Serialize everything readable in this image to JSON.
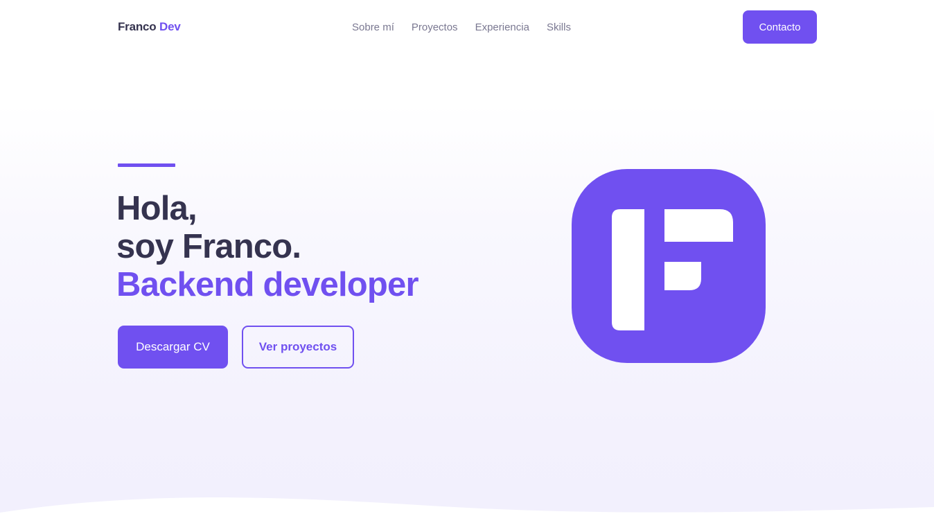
{
  "header": {
    "brand_first": "Franco",
    "brand_second": "Dev",
    "nav": [
      "Sobre mí",
      "Proyectos",
      "Experiencia",
      "Skills"
    ],
    "contact_label": "Contacto"
  },
  "hero": {
    "line1": "Hola,",
    "line2": "soy Franco.",
    "role": "Backend developer",
    "primary_button": "Descargar CV",
    "secondary_button": "Ver proyectos",
    "logo_icon": "franco-f-logo-icon"
  },
  "colors": {
    "accent": "#7050f0",
    "heading": "#35334f",
    "nav_text": "#7a7891",
    "background_tint": "#f2f0fd"
  }
}
